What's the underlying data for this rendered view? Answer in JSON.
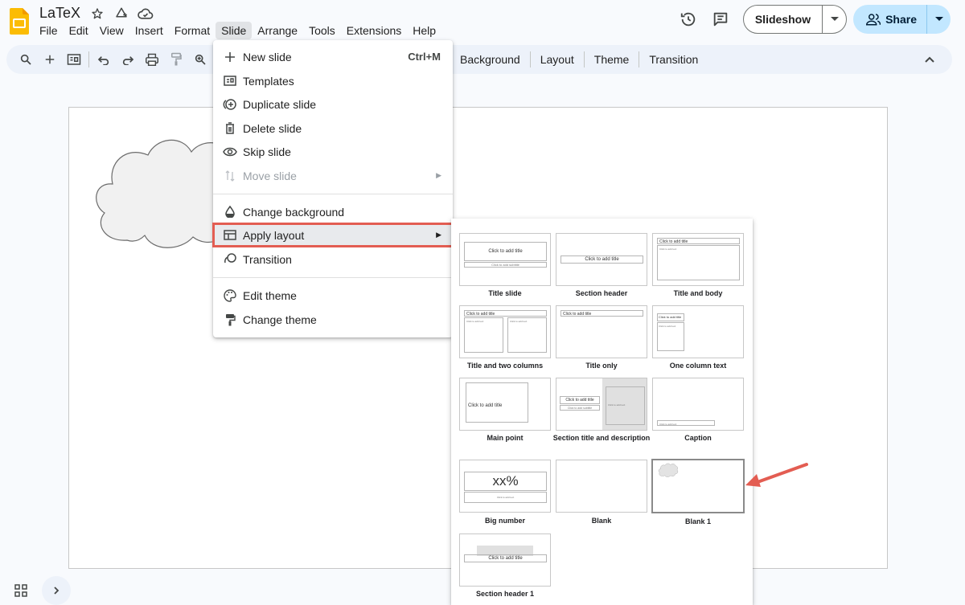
{
  "app": {
    "doc_title": "LaTeX",
    "brand_color": "#fbbc04"
  },
  "menubar": [
    "File",
    "Edit",
    "View",
    "Insert",
    "Format",
    "Slide",
    "Arrange",
    "Tools",
    "Extensions",
    "Help"
  ],
  "header": {
    "slideshow_label": "Slideshow",
    "share_label": "Share"
  },
  "toolbar": {
    "text_items": [
      "Background",
      "Layout",
      "Theme",
      "Transition"
    ]
  },
  "slide_menu": {
    "items": [
      {
        "label": "New slide",
        "shortcut": "Ctrl+M",
        "icon": "plus-icon"
      },
      {
        "label": "Templates",
        "icon": "templates-icon"
      },
      {
        "label": "Duplicate slide",
        "icon": "duplicate-icon"
      },
      {
        "label": "Delete slide",
        "icon": "trash-icon"
      },
      {
        "label": "Skip slide",
        "icon": "eye-icon"
      },
      {
        "label": "Move slide",
        "icon": "move-icon",
        "disabled": true,
        "submenu": true
      },
      {
        "label": "Change background",
        "icon": "fill-drop-icon"
      },
      {
        "label": "Apply layout",
        "icon": "layout-icon",
        "submenu": true,
        "highlighted": true
      },
      {
        "label": "Transition",
        "icon": "transition-icon"
      },
      {
        "label": "Edit theme",
        "icon": "palette-icon"
      },
      {
        "label": "Change theme",
        "icon": "paint-roller-icon"
      }
    ]
  },
  "layouts": {
    "items": [
      {
        "name": "Title slide"
      },
      {
        "name": "Section header"
      },
      {
        "name": "Title and body"
      },
      {
        "name": "Title and two columns"
      },
      {
        "name": "Title only"
      },
      {
        "name": "One column text"
      },
      {
        "name": "Main point"
      },
      {
        "name": "Section title and description"
      },
      {
        "name": "Caption"
      },
      {
        "name": "Big number"
      },
      {
        "name": "Blank"
      },
      {
        "name": "Blank 1",
        "selected": true
      },
      {
        "name": "Section header 1"
      }
    ],
    "placeholders": {
      "add_title": "Click to add title",
      "add_subtitle": "Click to add subtitle",
      "add_text": "Click to add text",
      "big_number": "xx%"
    }
  },
  "colors": {
    "highlight_outline": "#e35d52",
    "share_bg": "#c2e7ff"
  }
}
